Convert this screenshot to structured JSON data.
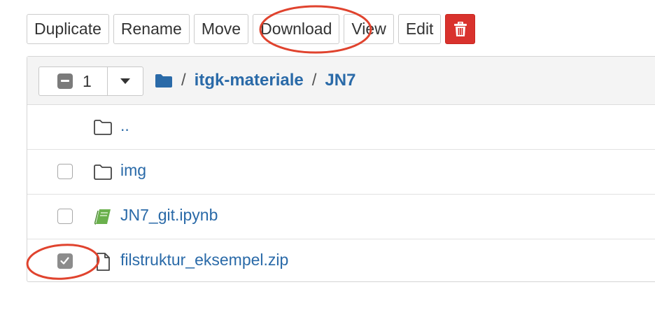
{
  "toolbar": {
    "duplicate_label": "Duplicate",
    "rename_label": "Rename",
    "move_label": "Move",
    "download_label": "Download",
    "view_label": "View",
    "edit_label": "Edit",
    "delete_icon": "trash-icon",
    "delete_color": "#d9322d"
  },
  "selection": {
    "count": "1",
    "state_icon": "minus-checkbox-icon",
    "dropdown_icon": "caret-down-icon"
  },
  "breadcrumb": {
    "root_icon": "folder-icon",
    "separator": "/",
    "items": [
      "itgk-materiale",
      "JN7"
    ]
  },
  "files": [
    {
      "name": "..",
      "icon": "folder-outline-icon",
      "has_checkbox": false,
      "checked": false
    },
    {
      "name": "img",
      "icon": "folder-outline-icon",
      "has_checkbox": true,
      "checked": false
    },
    {
      "name": "JN7_git.ipynb",
      "icon": "notebook-icon",
      "has_checkbox": true,
      "checked": false
    },
    {
      "name": "filstruktur_eksempel.zip",
      "icon": "file-icon",
      "has_checkbox": true,
      "checked": true
    }
  ],
  "colors": {
    "link": "#2a6aa8",
    "annotation": "#e0432e",
    "notebook_icon": "#6ab04c"
  }
}
